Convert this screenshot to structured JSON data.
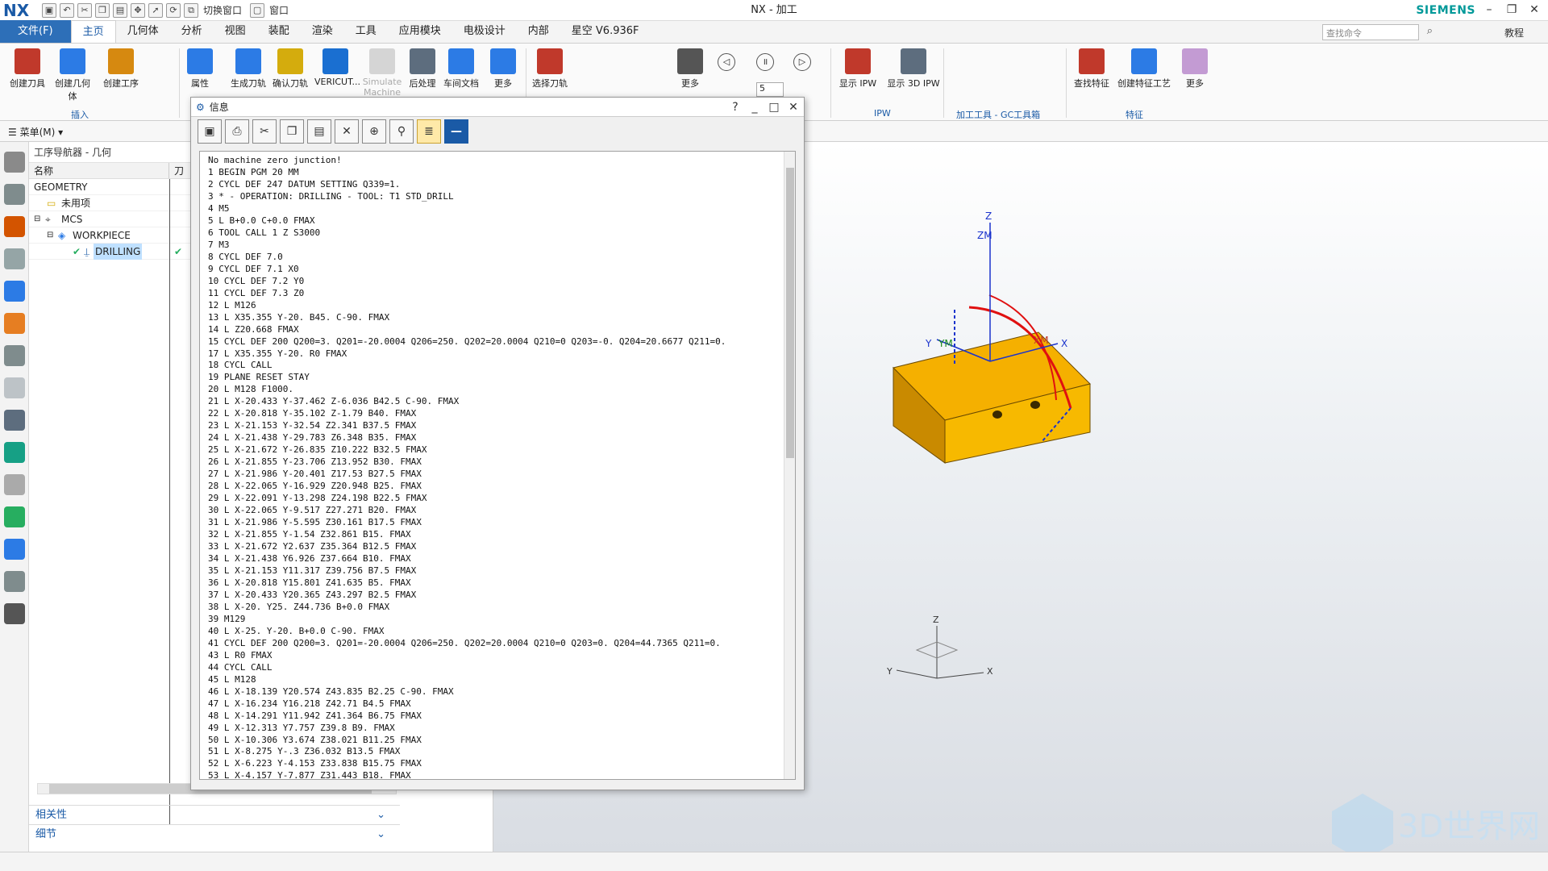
{
  "app": {
    "logo": "NX",
    "window_title": "NX - 加工",
    "brand": "SIEMENS",
    "switch_window": "切换窗口",
    "window_menu": "窗口"
  },
  "tabs": [
    "文件(F)",
    "主页",
    "几何体",
    "分析",
    "视图",
    "装配",
    "渲染",
    "工具",
    "应用模块",
    "电极设计",
    "内部",
    "星空 V6.936F"
  ],
  "search": {
    "placeholder": "查找命令"
  },
  "tutorial": "教程",
  "ribbon": {
    "buttons": [
      {
        "label": "创建刀具",
        "color": "#c0392b"
      },
      {
        "label": "创建几何体",
        "color": "#2c7be5"
      },
      {
        "label": "创建工序",
        "color": "#d68910"
      },
      {
        "label": "属性",
        "color": "#2c7be5"
      },
      {
        "label": "生成刀轨",
        "color": "#2c7be5"
      },
      {
        "label": "确认刀轨",
        "color": "#d4ac0d"
      },
      {
        "label": "VERICUT...",
        "color": "#1a6fd1"
      },
      {
        "label": "Simulate Machine",
        "color": "#b0b0b0"
      },
      {
        "label": "后处理",
        "color": "#5d6d7e"
      },
      {
        "label": "车间文档",
        "color": "#2c7be5"
      },
      {
        "label": "更多",
        "color": "#2c7be5"
      },
      {
        "label": "选择刀轨",
        "color": "#c0392b"
      },
      {
        "label": "更多",
        "color": "#555555"
      },
      {
        "label": "显示 IPW",
        "color": "#c0392b"
      },
      {
        "label": "显示 3D IPW",
        "color": "#5d6d7e"
      },
      {
        "label": "查找特征",
        "color": "#c0392b"
      },
      {
        "label": "创建特征工艺",
        "color": "#2c7be5"
      },
      {
        "label": "更多",
        "color": "#c39bd3"
      }
    ],
    "groups": {
      "insert": "插入",
      "ipw": "IPW",
      "gc": "加工工具 - GC工具箱",
      "feature": "特征"
    },
    "spinner_value": "5"
  },
  "menu_button": "菜单(M)",
  "navigator": {
    "title": "工序导航器 - 几何",
    "col_name": "名称",
    "col_tool": "刀",
    "rows": [
      {
        "label": "GEOMETRY",
        "indent": 0
      },
      {
        "label": "未用项",
        "indent": 1
      },
      {
        "label": "MCS",
        "indent": 1
      },
      {
        "label": "WORKPIECE",
        "indent": 2
      },
      {
        "label": "DRILLING",
        "indent": 3,
        "selected": true
      }
    ],
    "sections": [
      "相关性",
      "细节"
    ]
  },
  "dialog": {
    "title": "信息",
    "lines": [
      "No machine zero junction!",
      "1 BEGIN PGM 20 MM",
      "2 CYCL DEF 247 DATUM SETTING Q339=1.",
      "3 * - OPERATION: DRILLING - TOOL: T1 STD_DRILL",
      "4 M5",
      "5 L B+0.0 C+0.0 FMAX",
      "6 TOOL CALL 1 Z S3000",
      "7 M3",
      "8 CYCL DEF 7.0",
      "9 CYCL DEF 7.1 X0",
      "10 CYCL DEF 7.2 Y0",
      "11 CYCL DEF 7.3 Z0",
      "12 L M126",
      "13 L X35.355 Y-20. B45. C-90. FMAX",
      "14 L Z20.668 FMAX",
      "15 CYCL DEF 200 Q200=3. Q201=-20.0004 Q206=250. Q202=20.0004 Q210=0 Q203=-0. Q204=20.6677 Q211=0.",
      "17 L X35.355 Y-20. R0 FMAX",
      "18 CYCL CALL",
      "19 PLANE RESET STAY",
      "20 L M128 F1000.",
      "21 L X-20.433 Y-37.462 Z-6.036 B42.5 C-90. FMAX",
      "22 L X-20.818 Y-35.102 Z-1.79 B40. FMAX",
      "23 L X-21.153 Y-32.54 Z2.341 B37.5 FMAX",
      "24 L X-21.438 Y-29.783 Z6.348 B35. FMAX",
      "25 L X-21.672 Y-26.835 Z10.222 B32.5 FMAX",
      "26 L X-21.855 Y-23.706 Z13.952 B30. FMAX",
      "27 L X-21.986 Y-20.401 Z17.53 B27.5 FMAX",
      "28 L X-22.065 Y-16.929 Z20.948 B25. FMAX",
      "29 L X-22.091 Y-13.298 Z24.198 B22.5 FMAX",
      "30 L X-22.065 Y-9.517 Z27.271 B20. FMAX",
      "31 L X-21.986 Y-5.595 Z30.161 B17.5 FMAX",
      "32 L X-21.855 Y-1.54 Z32.861 B15. FMAX",
      "33 L X-21.672 Y2.637 Z35.364 B12.5 FMAX",
      "34 L X-21.438 Y6.926 Z37.664 B10. FMAX",
      "35 L X-21.153 Y11.317 Z39.756 B7.5 FMAX",
      "36 L X-20.818 Y15.801 Z41.635 B5. FMAX",
      "37 L X-20.433 Y20.365 Z43.297 B2.5 FMAX",
      "38 L X-20. Y25. Z44.736 B+0.0 FMAX",
      "39 M129",
      "40 L X-25. Y-20. B+0.0 C-90. FMAX",
      "41 CYCL DEF 200 Q200=3. Q201=-20.0004 Q206=250. Q202=20.0004 Q210=0 Q203=0. Q204=44.7365 Q211=0.",
      "43 L R0 FMAX",
      "44 CYCL CALL",
      "45 L M128",
      "46 L X-18.139 Y20.574 Z43.835 B2.25 C-90. FMAX",
      "47 L X-16.234 Y16.218 Z42.71 B4.5 FMAX",
      "48 L X-14.291 Y11.942 Z41.364 B6.75 FMAX",
      "49 L X-12.313 Y7.757 Z39.8 B9. FMAX",
      "50 L X-10.306 Y3.674 Z38.021 B11.25 FMAX",
      "51 L X-8.275 Y-.3 Z36.032 B13.5 FMAX",
      "52 L X-6.223 Y-4.153 Z33.838 B15.75 FMAX",
      "53 L X-4.157 Y-7.877 Z31.443 B18. FMAX"
    ]
  },
  "viewport": {
    "axis_labels": {
      "z": "Z",
      "zm": "ZM",
      "y": "Y",
      "ym": "YM",
      "x": "X",
      "xm": "XM"
    },
    "triad": {
      "z": "Z",
      "y": "Y",
      "x": "X"
    },
    "part_color": "#f5b000",
    "watermark": "3D世界网",
    "watermark_sub": "WWW.3DSJW.COM"
  }
}
